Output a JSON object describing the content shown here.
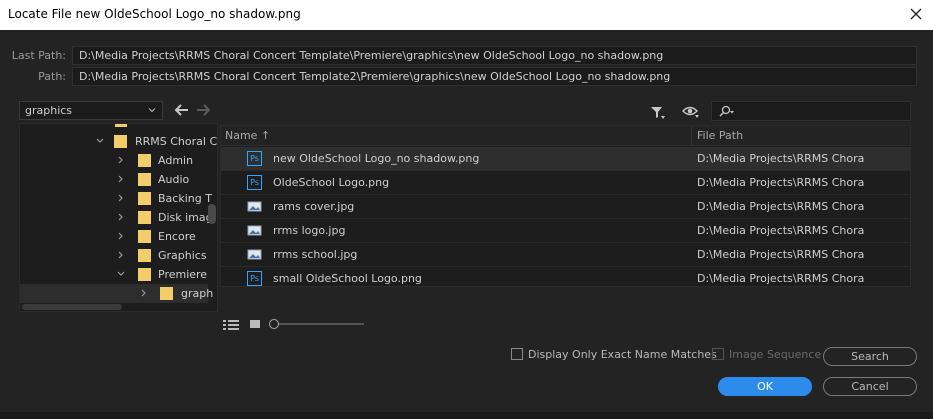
{
  "window": {
    "title": "Locate File new OldeSchool Logo_no shadow.png"
  },
  "paths": {
    "last_path_label": "Last Path:",
    "last_path_value": "D:\\Media Projects\\RRMS Choral Concert Template\\Premiere\\graphics\\new OldeSchool Logo_no shadow.png",
    "path_label": "Path:",
    "path_value": "D:\\Media Projects\\RRMS Choral Concert Template2\\Premiere\\graphics\\new OldeSchool Logo_no shadow.png"
  },
  "location_dropdown": {
    "value": "graphics"
  },
  "tree": {
    "items": [
      {
        "label": "RRMS Choral C",
        "expanded": true
      },
      {
        "label": "Admin",
        "expanded": false
      },
      {
        "label": "Audio",
        "expanded": false
      },
      {
        "label": "Backing T",
        "expanded": false
      },
      {
        "label": "Disk imag",
        "expanded": false
      },
      {
        "label": "Encore",
        "expanded": false
      },
      {
        "label": "Graphics",
        "expanded": false
      },
      {
        "label": "Premiere",
        "expanded": true
      },
      {
        "label": "graph",
        "expanded": false
      }
    ]
  },
  "file_list": {
    "col_name": "Name",
    "col_path": "File Path",
    "rows": [
      {
        "name": "new OldeSchool Logo_no shadow.png",
        "path": "D:\\Media Projects\\RRMS Choral C",
        "icon": "ps-file-icon"
      },
      {
        "name": "OldeSchool Logo.png",
        "path": "D:\\Media Projects\\RRMS Choral C",
        "icon": "ps-file-icon"
      },
      {
        "name": "rams cover.jpg",
        "path": "D:\\Media Projects\\RRMS Choral C",
        "icon": "image-file-icon"
      },
      {
        "name": "rrms logo.jpg",
        "path": "D:\\Media Projects\\RRMS Choral C",
        "icon": "image-file-icon"
      },
      {
        "name": "rrms school.jpg",
        "path": "D:\\Media Projects\\RRMS Choral C",
        "icon": "image-file-icon"
      },
      {
        "name": "small OldeSchool Logo.png",
        "path": "D:\\Media Projects\\RRMS Choral C",
        "icon": "ps-file-icon"
      }
    ]
  },
  "options": {
    "exact_name_label": "Display Only Exact Name Matches",
    "image_sequence_label": "Image Sequence"
  },
  "buttons": {
    "search": "Search",
    "ok": "OK",
    "cancel": "Cancel"
  },
  "colors": {
    "accent": "#2d8ceb",
    "folder": "#f2cd6a",
    "ps_icon": "#31a8ff"
  }
}
